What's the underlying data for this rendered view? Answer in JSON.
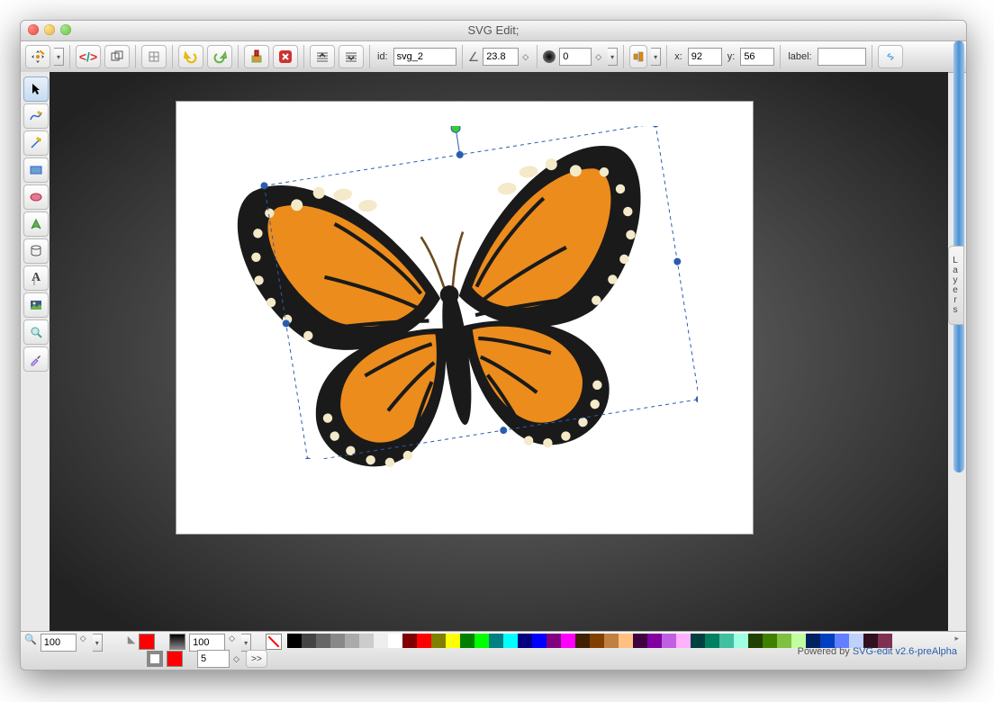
{
  "window": {
    "title": "SVG Edit;"
  },
  "toolbar": {
    "id_label": "id:",
    "id_value": "svg_2",
    "rotate_value": "23.8",
    "opacity_value": "0",
    "x_label": "x:",
    "x_value": "92",
    "y_label": "y:",
    "y_value": "56",
    "label_label": "label:",
    "label_value": ""
  },
  "bottom": {
    "zoom_value": "100",
    "fill_value": "100",
    "stroke_width": "5",
    "stroke_btn": ">>",
    "credit_prefix": "Powered by ",
    "credit_link": "SVG-edit v2.6-preAlpha"
  },
  "layers": {
    "label": "Layers"
  },
  "palette_colors": [
    "#000000",
    "#444444",
    "#666666",
    "#888888",
    "#aaaaaa",
    "#cccccc",
    "#eeeeee",
    "#ffffff",
    "#800000",
    "#ff0000",
    "#808000",
    "#ffff00",
    "#008000",
    "#00ff00",
    "#008080",
    "#00ffff",
    "#000080",
    "#0000ff",
    "#800080",
    "#ff00ff",
    "#402000",
    "#804000",
    "#c08040",
    "#ffc080",
    "#400040",
    "#8000a0",
    "#c060e0",
    "#ffb0ff",
    "#004040",
    "#008060",
    "#40c0a0",
    "#a0ffe0",
    "#204000",
    "#408000",
    "#80c040",
    "#c0ffa0",
    "#002060",
    "#0040c0",
    "#6080ff",
    "#c0d0ff",
    "#301020",
    "#803050"
  ]
}
